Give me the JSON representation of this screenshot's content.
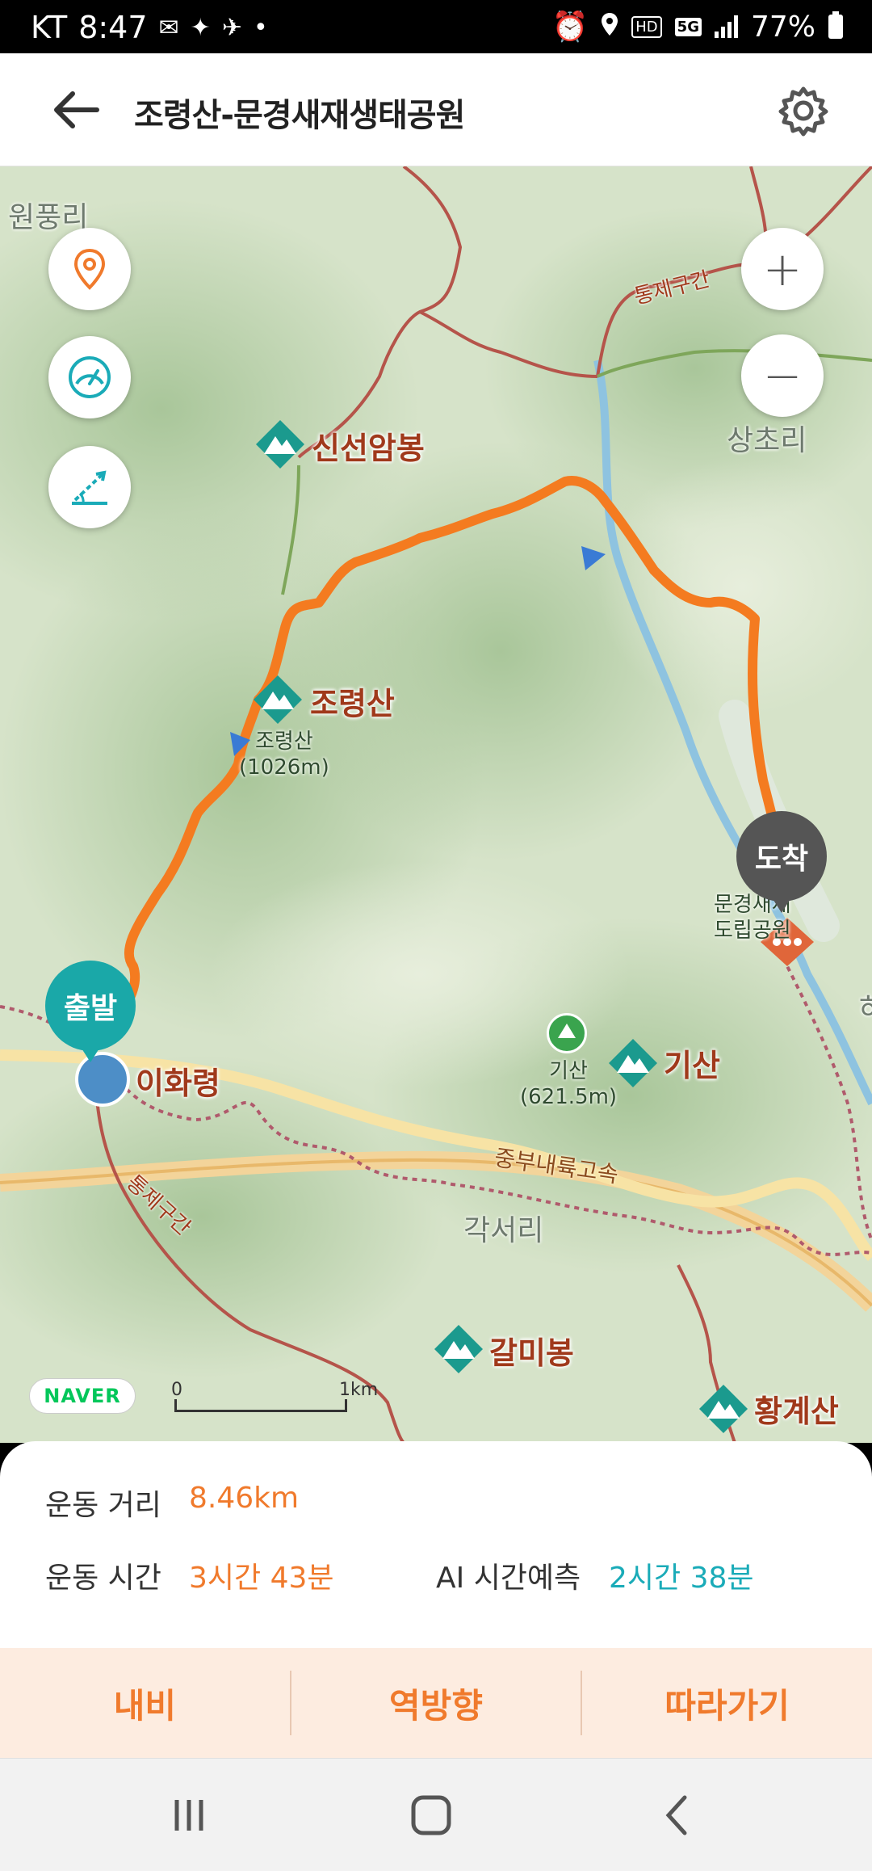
{
  "status_bar": {
    "carrier": "KT",
    "time": "8:47",
    "hd": "HD",
    "network": "5G",
    "battery": "77%"
  },
  "header": {
    "title": "조령산-문경새재생태공원",
    "back_icon": "arrow-left-icon",
    "settings_icon": "gear-icon"
  },
  "map": {
    "regions": [
      "원풍리",
      "상초리",
      "각서리",
      "하"
    ],
    "peaks": [
      "신선암봉",
      "조령산",
      "기산",
      "갈미봉",
      "황계산",
      "이화령"
    ],
    "peak_sub_labels": {
      "joryeong": "조령산\n(1026m)",
      "gisan": "기산\n(621.5m)",
      "hwanggye": "황계산",
      "park": "문경새재\n도립공원"
    },
    "road_labels": [
      "통제구간",
      "통제구간",
      "중부내륙고속"
    ],
    "start_label": "출발",
    "end_label": "도착",
    "naver_logo": "NAVER",
    "scale": {
      "start": "0",
      "end": "1km"
    },
    "controls": [
      "location-pin-icon",
      "speedometer-icon",
      "elevation-icon"
    ],
    "zoom_in": "+",
    "zoom_out": "−",
    "route_color": "#f47b20"
  },
  "stats": {
    "distance_label": "운동 거리",
    "distance_value": "8.46km",
    "time_label": "운동 시간",
    "time_value": "3시간 43분",
    "ai_label": "AI 시간예측",
    "ai_value": "2시간 38분"
  },
  "actions": {
    "navi": "내비",
    "reverse": "역방향",
    "follow": "따라가기"
  },
  "nav_bar": [
    "recent-apps-icon",
    "home-icon",
    "back-icon"
  ],
  "colors": {
    "accent": "#f07a2c",
    "teal": "#1aa8a8",
    "ai": "#1aabb8"
  }
}
